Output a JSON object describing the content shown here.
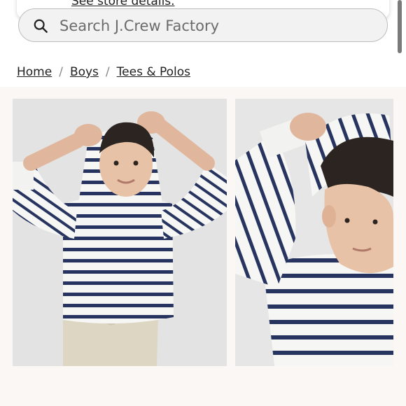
{
  "popup": {
    "link_text": "See store details."
  },
  "search": {
    "placeholder": "Search J.Crew Factory",
    "icon": "search-icon"
  },
  "breadcrumb": {
    "items": [
      {
        "label": "Home"
      },
      {
        "label": "Boys"
      },
      {
        "label": "Tees & Polos"
      }
    ],
    "separator": "/"
  },
  "gallery": {
    "images": [
      {
        "subject": "boy wearing navy and white striped hooded tee, hands on hood, khaki pants"
      },
      {
        "subject": "close-up of boy pulling striped hood over head"
      }
    ]
  },
  "colors": {
    "stripe_navy": "#26345f",
    "shirt_white": "#f6f6f4",
    "photo_bg": "#e3e3e3",
    "gallery_bg": "#fbf7f4"
  }
}
